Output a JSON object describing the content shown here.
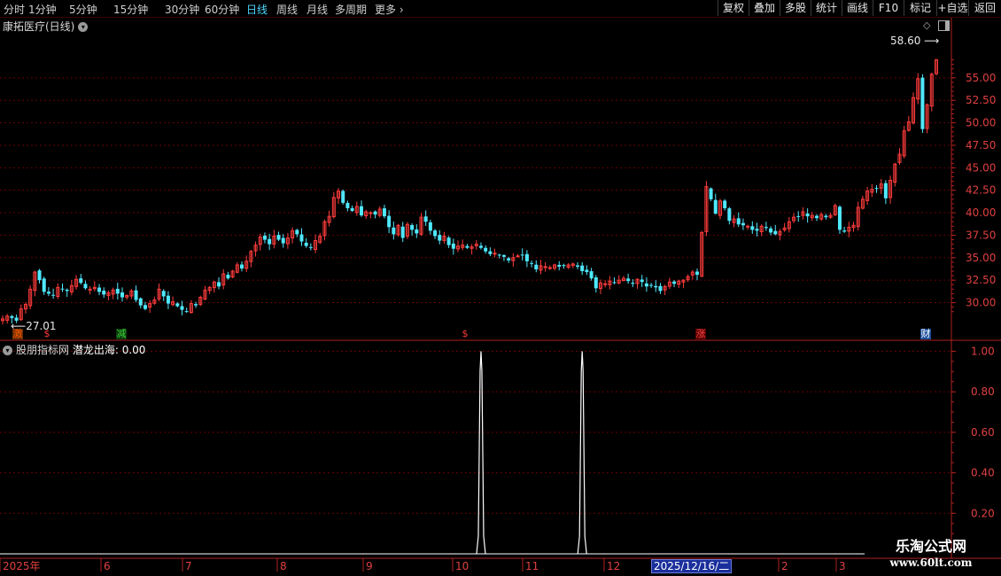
{
  "toolbar": {
    "timeframes": [
      "分时",
      "1分钟",
      "5分钟",
      "15分钟",
      "30分钟",
      "60分钟",
      "日线",
      "周线",
      "月线",
      "多周期",
      "更多"
    ],
    "active_timeframe": "日线",
    "more_arrow": "›",
    "buttons": [
      "复权",
      "叠加",
      "多股",
      "统计",
      "画线",
      "F10",
      "标记",
      "+自选",
      "返回"
    ]
  },
  "chart_title": "康拓医疗(日线)",
  "indicator": {
    "source": "股朋指标网",
    "name": "潜龙出海",
    "value": "0.00"
  },
  "annotations": {
    "high_label": "58.60",
    "low_label": "27.01"
  },
  "signals": [
    {
      "text": "激",
      "color": "#ff5a00",
      "bg": "#6b2d00"
    },
    {
      "text": "$",
      "color": "#ff3b3b",
      "bg": ""
    },
    {
      "text": "减",
      "color": "#3cd23c",
      "bg": "#0a3a0a"
    },
    {
      "text": "$",
      "color": "#ff3b3b",
      "bg": ""
    },
    {
      "text": "涨",
      "color": "#ff4444",
      "bg": "#5a0000"
    },
    {
      "text": "财",
      "color": "#ffffff",
      "bg": "#1b4f9c"
    }
  ],
  "x_axis": {
    "labels": [
      "2025年",
      "6",
      "7",
      "8",
      "9",
      "10",
      "11",
      "12",
      "2",
      "3"
    ],
    "cursor_date": "2025/12/16/二"
  },
  "watermark": {
    "line1": "乐淘公式网",
    "line2": "www.60lt.com"
  },
  "colors": {
    "up": "#ff3c3c",
    "down": "#4fe8ff",
    "grid": "#6a0000",
    "axis": "#b02020",
    "indicator_line": "#ffffff"
  },
  "chart_data": [
    {
      "type": "candlestick",
      "title": "康拓医疗(日线)",
      "ylim": [
        27.0,
        60.5
      ],
      "y_ticks": [
        30.0,
        32.5,
        35.0,
        37.5,
        40.0,
        42.5,
        45.0,
        47.5,
        50.0,
        52.5,
        55.0
      ],
      "high": 58.6,
      "low": 27.01,
      "closes": [
        28.2,
        28.5,
        28.3,
        28.0,
        29.3,
        29.8,
        31.5,
        33.4,
        32.5,
        31.2,
        31.0,
        30.8,
        31.7,
        31.5,
        31.3,
        31.9,
        32.6,
        32.2,
        31.6,
        31.5,
        31.7,
        31.2,
        30.9,
        31.1,
        31.4,
        31.0,
        30.6,
        30.8,
        31.3,
        30.3,
        29.7,
        29.3,
        29.9,
        30.3,
        31.5,
        30.7,
        29.9,
        30.1,
        29.6,
        29.2,
        29.0,
        29.9,
        29.7,
        30.6,
        31.4,
        31.7,
        32.3,
        31.8,
        33.2,
        32.7,
        33.5,
        34.2,
        33.8,
        34.6,
        35.7,
        36.4,
        37.3,
        37.0,
        36.5,
        37.4,
        37.0,
        36.6,
        37.2,
        38.0,
        37.6,
        36.8,
        36.3,
        36.1,
        36.9,
        37.4,
        39.0,
        39.6,
        41.7,
        42.4,
        41.1,
        40.5,
        40.2,
        40.7,
        39.7,
        40.1,
        40.0,
        39.8,
        40.4,
        39.6,
        38.4,
        37.6,
        38.6,
        37.2,
        38.7,
        38.1,
        37.7,
        39.5,
        39.0,
        38.0,
        37.4,
        36.9,
        37.4,
        36.4,
        36.0,
        36.3,
        36.4,
        36.1,
        36.2,
        36.5,
        36.1,
        35.7,
        35.4,
        35.5,
        35.3,
        35.1,
        34.7,
        35.0,
        35.2,
        35.3,
        34.6,
        34.4,
        33.7,
        34.1,
        34.0,
        33.9,
        34.2,
        34.0,
        34.1,
        34.2,
        34.3,
        34.0,
        33.5,
        33.4,
        32.7,
        31.6,
        32.2,
        32.1,
        32.4,
        32.2,
        32.5,
        32.7,
        32.4,
        32.1,
        32.6,
        32.3,
        31.8,
        31.9,
        31.7,
        31.3,
        31.8,
        32.3,
        32.1,
        32.4,
        32.5,
        32.9,
        33.4,
        33.1,
        37.8,
        42.9,
        41.5,
        39.9,
        41.3,
        40.5,
        39.1,
        39.3,
        38.7,
        38.6,
        38.5,
        38.1,
        38.0,
        38.5,
        38.3,
        37.8,
        37.6,
        37.9,
        38.3,
        39.0,
        39.5,
        39.6,
        40.1,
        39.6,
        39.7,
        39.4,
        39.8,
        39.5,
        39.7,
        40.8,
        38.1,
        37.9,
        38.4,
        38.6,
        40.6,
        41.5,
        42.4,
        42.6,
        42.7,
        43.2,
        41.6,
        43.6,
        45.4,
        46.5,
        49.1,
        50.1,
        52.8,
        54.9,
        49.3,
        52.0,
        55.4,
        57.0
      ]
    },
    {
      "type": "line",
      "title": "潜龙出海",
      "ylim": [
        0.0,
        1.05
      ],
      "y_ticks": [
        0.2,
        0.4,
        0.6,
        0.8,
        1.0
      ],
      "series": [
        {
          "name": "潜龙出海",
          "values": [
            0,
            0,
            0,
            0,
            0,
            0,
            0,
            0,
            0,
            0,
            0,
            0,
            0,
            0,
            0,
            0,
            0,
            0,
            0,
            0,
            0,
            0,
            0,
            0,
            0,
            0,
            0,
            0,
            0,
            0,
            0,
            0,
            0,
            0,
            0,
            0,
            0,
            0,
            0,
            0,
            0,
            0,
            0,
            0,
            0,
            0,
            0,
            0,
            0,
            0,
            0,
            0,
            0,
            0,
            0,
            0,
            0,
            0,
            0,
            0,
            0,
            0,
            0,
            0,
            0,
            0,
            0,
            0,
            0,
            0,
            0,
            0,
            0,
            0,
            0,
            0,
            0,
            0,
            0,
            0,
            0,
            0,
            0,
            0,
            0,
            0,
            0,
            0,
            0,
            0,
            0,
            0,
            0,
            0,
            0,
            0,
            0,
            0,
            0,
            0,
            0,
            0,
            0,
            0,
            0,
            0,
            0,
            0,
            0,
            0,
            0,
            0,
            0,
            0,
            0,
            0,
            0,
            0,
            0,
            0,
            0,
            0,
            0,
            0,
            0,
            0,
            0,
            0,
            0,
            0,
            0,
            0,
            0,
            0,
            0,
            0,
            0,
            0,
            0,
            0,
            0,
            0,
            0,
            0,
            0,
            0,
            0,
            0,
            0,
            0,
            0,
            0,
            0,
            0,
            0,
            0,
            0,
            0,
            0,
            0,
            0,
            0,
            0,
            0,
            0,
            0,
            0,
            0,
            0,
            0,
            0,
            0,
            0,
            0,
            0,
            0,
            0,
            0,
            0,
            0,
            0,
            0,
            0,
            0,
            0,
            0,
            0,
            0,
            0,
            0,
            0,
            0,
            0,
            0,
            0,
            0,
            0,
            0,
            0,
            0,
            0,
            0,
            0,
            0,
            0,
            0,
            0,
            0,
            0,
            0,
            0,
            0,
            0
          ]
        }
      ],
      "spikes": [
        {
          "value": 1.0
        },
        {
          "value": 1.0
        }
      ]
    }
  ]
}
